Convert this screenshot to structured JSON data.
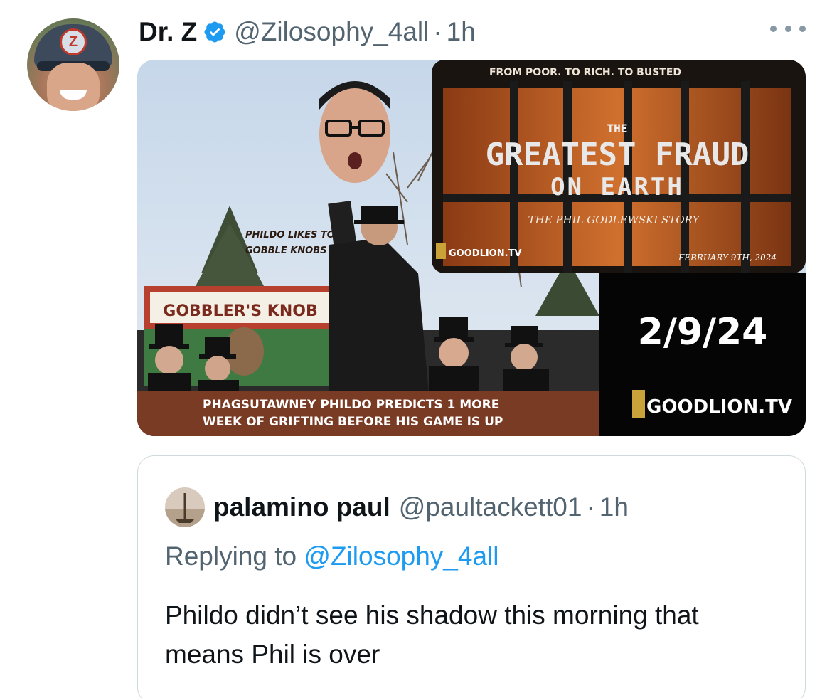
{
  "tweet": {
    "author_name": "Dr. Z",
    "author_handle": "@Zilosophy_4all",
    "separator": "·",
    "time": "1h",
    "avatar_cap_logo": "Z"
  },
  "media": {
    "left_caption_line1": "PHILDO LIKES TO",
    "left_caption_line2": "GOBBLE KNOBS",
    "sign_text": "GOBBLER'S KNOB",
    "bottom_banner_line1": "PHAGSUTAWNEY PHILDO PREDICTS 1 MORE",
    "bottom_banner_line2": "WEEK OF GRIFTING BEFORE HIS GAME IS UP",
    "poster_tagline": "FROM POOR. TO RICH. TO BUSTED",
    "poster_the": "THE",
    "poster_title_line1": "GREATEST FRAUD",
    "poster_title_line2": "ON EARTH",
    "poster_subtitle": "THE PHIL GODLEWSKI STORY",
    "poster_brand": "GOODLION.TV",
    "poster_date": "FEBRUARY 9TH, 2024",
    "big_date": "2/9/24",
    "big_brand": "GOODLION.TV"
  },
  "quote": {
    "author_name": "palamino paul",
    "author_handle": "@paultackett01",
    "separator": "·",
    "time": "1h",
    "replying_prefix": "Replying to ",
    "replying_handle": "@Zilosophy_4all",
    "body": "Phildo didn’t see his shadow this morning that means Phil is over"
  },
  "colors": {
    "accent": "#1d9bf0",
    "secondary_text": "#536471",
    "primary_text": "#0f1419",
    "border": "#cfd9de",
    "banner": "#7a3b24",
    "poster_orange": "#c8642a"
  },
  "icons": {
    "verified": "verified-badge-icon",
    "more": "more-icon"
  }
}
